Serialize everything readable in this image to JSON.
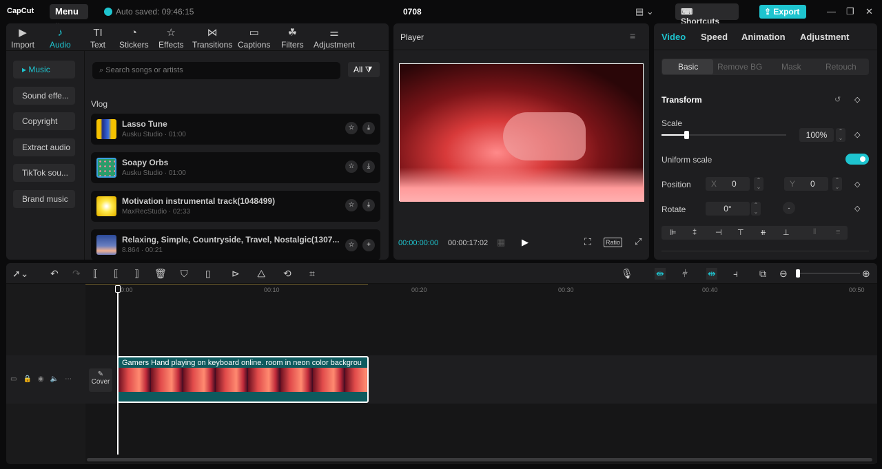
{
  "app": {
    "logo": "CapCut",
    "menu": "Menu",
    "autosave": "Auto saved: 09:46:15",
    "project_title": "0708",
    "shortcuts": "Shortcuts",
    "export": "Export"
  },
  "toolbar_tabs": [
    {
      "label": "Import",
      "icon": "import-icon"
    },
    {
      "label": "Audio",
      "icon": "audio-icon",
      "active": true
    },
    {
      "label": "Text",
      "icon": "text-icon"
    },
    {
      "label": "Stickers",
      "icon": "sticker-icon"
    },
    {
      "label": "Effects",
      "icon": "effects-icon"
    },
    {
      "label": "Transitions",
      "icon": "transitions-icon"
    },
    {
      "label": "Captions",
      "icon": "captions-icon"
    },
    {
      "label": "Filters",
      "icon": "filters-icon"
    },
    {
      "label": "Adjustment",
      "icon": "adjustment-icon"
    }
  ],
  "audio_sidebar": [
    "Music",
    "Sound effe...",
    "Copyright",
    "Extract audio",
    "TikTok sou...",
    "Brand music"
  ],
  "search": {
    "placeholder": "Search songs or artists",
    "filter": "All"
  },
  "section": "Vlog",
  "songs": [
    {
      "name": "Lasso Tune",
      "meta": "Ausku Studio · 01:00",
      "action": "download"
    },
    {
      "name": "Soapy Orbs",
      "meta": "Ausku Studio · 01:00",
      "action": "download"
    },
    {
      "name": "Motivation instrumental track(1048499)",
      "meta": "MaxRecStudio · 02:33",
      "action": "download"
    },
    {
      "name": "Relaxing, Simple, Countryside, Travel, Nostalgic(1307...",
      "meta": "8.864 · 00:21",
      "action": "add"
    }
  ],
  "player": {
    "title": "Player",
    "current": "00:00:00:00",
    "duration": "00:00:17:02",
    "ratio": "Ratio"
  },
  "inspector": {
    "tabs": [
      "Video",
      "Speed",
      "Animation",
      "Adjustment"
    ],
    "subtabs": [
      "Basic",
      "Remove BG",
      "Mask",
      "Retouch"
    ],
    "transform": "Transform",
    "scale_label": "Scale",
    "scale": "100%",
    "scale_value": 100,
    "uniform_label": "Uniform scale",
    "uniform": true,
    "position_label": "Position",
    "x_label": "X",
    "x": "0",
    "y_label": "Y",
    "y": "0",
    "rotate_label": "Rotate",
    "rotate": "0°"
  },
  "timeline": {
    "ticks": [
      "00:00",
      "00:10",
      "00:20",
      "00:30",
      "00:40",
      "00:50"
    ],
    "clip_title": "Gamers Hand playing on keyboard online. room  in neon color backgrou",
    "cover": "Cover"
  },
  "colors": {
    "accent": "#1ec4cf",
    "clip": "#0e5a5e"
  }
}
